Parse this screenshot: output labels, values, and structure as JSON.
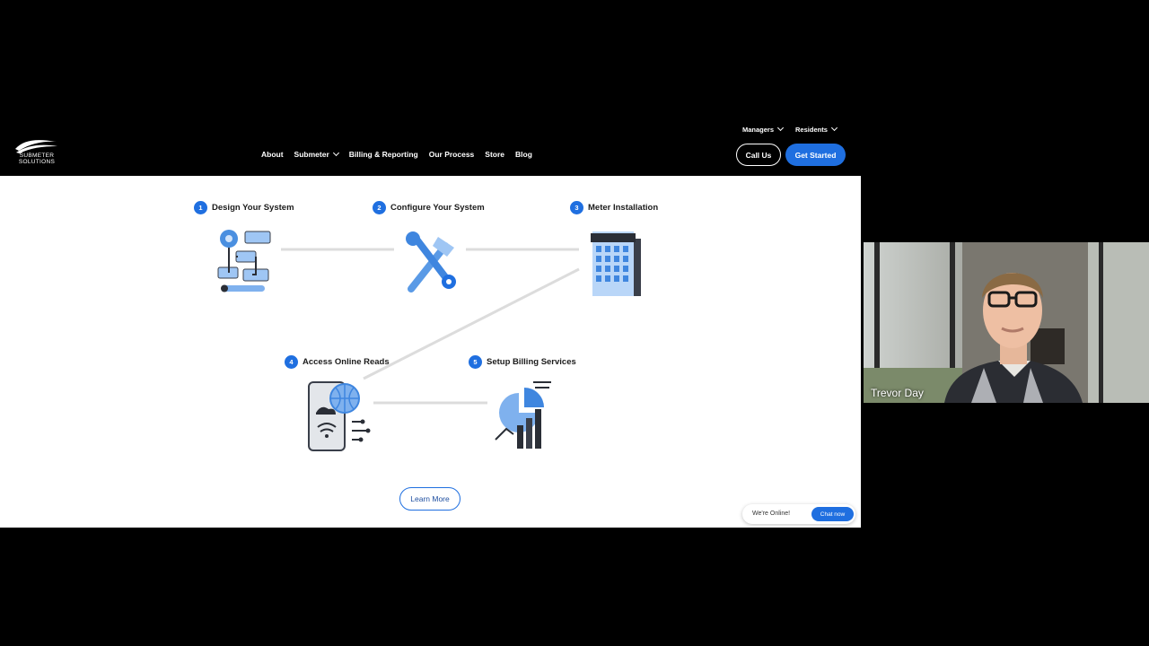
{
  "nav": {
    "logo_text_line1": "SUBMETER",
    "logo_text_line2": "SOLUTIONS",
    "items": [
      {
        "label": "About"
      },
      {
        "label": "Submeter"
      },
      {
        "label": "Billing & Reporting"
      },
      {
        "label": "Our Process"
      },
      {
        "label": "Store"
      },
      {
        "label": "Blog"
      }
    ],
    "top_links": [
      {
        "label": "Managers"
      },
      {
        "label": "Residents"
      }
    ],
    "call_label": "Call Us",
    "start_label": "Get Started"
  },
  "process": {
    "steps": [
      {
        "number": "1",
        "title": "Design Your System",
        "icon": "system-design-icon"
      },
      {
        "number": "2",
        "title": "Configure Your System",
        "icon": "tools-icon"
      },
      {
        "number": "3",
        "title": "Meter Installation",
        "icon": "building-icon"
      },
      {
        "number": "4",
        "title": "Access Online Reads",
        "icon": "mobile-globe-icon"
      },
      {
        "number": "5",
        "title": "Setup Billing Services",
        "icon": "billing-chart-icon"
      }
    ],
    "learn_more_label": "Learn More"
  },
  "chat": {
    "status": "We're Online!",
    "button_label": "Chat now"
  },
  "participant": {
    "name": "Trevor Day"
  },
  "colors": {
    "accent": "#1f6fe0",
    "nav_bg": "#000000",
    "page_bg": "#ffffff"
  }
}
